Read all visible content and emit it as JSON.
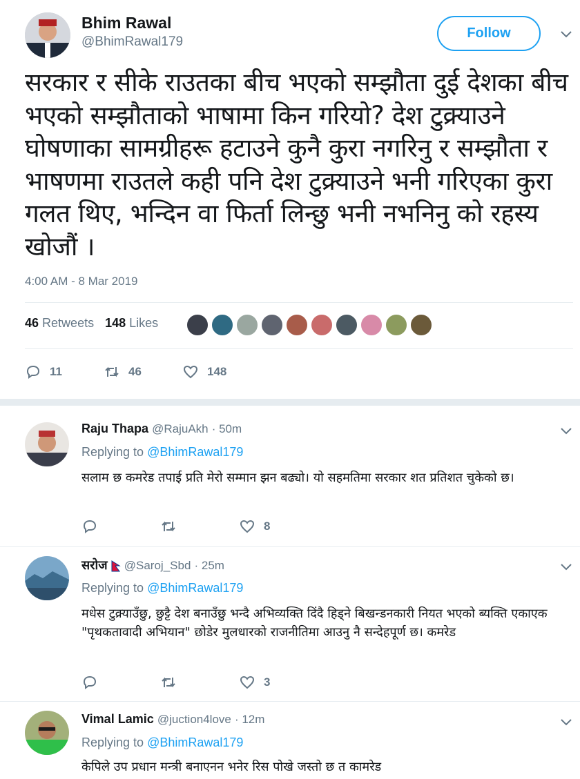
{
  "main_tweet": {
    "author_name": "Bhim Rawal",
    "author_handle": "@BhimRawal179",
    "follow_label": "Follow",
    "text": "सरकार र सीके राउतका बीच भएको सम्झौता दुई देशका बीच भएको सम्झौताको भाषामा किन गरियो? देश टुक्र्याउने घोषणाका सामग्रीहरू हटाउने कुनै कुरा नगरिनु र सम्झौता र भाषणमा राउतले कही पनि देश टुक्र्याउने भनी गरिएका कुरा गलत थिए, भन्दिन वा फिर्ता लिन्छु भनी नभनिनु को रहस्य खोजौं ।",
    "timestamp": "4:00 AM - 8 Mar 2019",
    "retweets_count": "46",
    "retweets_label": "Retweets",
    "likes_count": "148",
    "likes_label": "Likes",
    "actions": {
      "replies": "11",
      "retweets": "46",
      "likes": "148"
    }
  },
  "replies": [
    {
      "name": "Raju Thapa",
      "handle": "@RajuAkh",
      "time": "· 50m",
      "replying_prefix": "Replying to",
      "replying_to": "@BhimRawal179",
      "text": "सलाम छ कमरेड तपाई प्रति मेरो सम्मान झन बढ्यो। यो सहमतिमा सरकार शत प्रतिशत चुकेको छ।",
      "actions": {
        "replies": "",
        "retweets": "",
        "likes": "8"
      }
    },
    {
      "name": "सरोज",
      "handle": "@Saroj_Sbd",
      "time": "· 25m",
      "replying_prefix": "Replying to",
      "replying_to": "@BhimRawal179",
      "text": "मधेस टुक्र्याउँछु, छुट्टै देश बनाउँछु भन्दै अभिव्यक्ति दिंदै हिड्ने बिखन्डनकारी नियत भएको ब्यक्ति एकाएक \"पृथकतावादी अभियान\" छोडेर मुलधारको राजनीतिमा आउनु नै सन्देहपूर्ण छ। कमरेड",
      "actions": {
        "replies": "",
        "retweets": "",
        "likes": "3"
      }
    },
    {
      "name": "Vimal Lamic",
      "handle": "@juction4love",
      "time": "· 12m",
      "replying_prefix": "Replying to",
      "replying_to": "@BhimRawal179",
      "text": "केपिले उप प्रधान मन्त्री बनाएनन भनेर रिस पोखे जस्तो छ त कामरेड"
    }
  ],
  "colors": {
    "brand_blue": "#1da1f2",
    "muted": "#657786",
    "text": "#14171a",
    "divider": "#e6ecf0"
  },
  "icons": [
    "chevron-down-icon",
    "reply-icon",
    "retweet-icon",
    "like-icon",
    "nepal-flag-icon"
  ]
}
